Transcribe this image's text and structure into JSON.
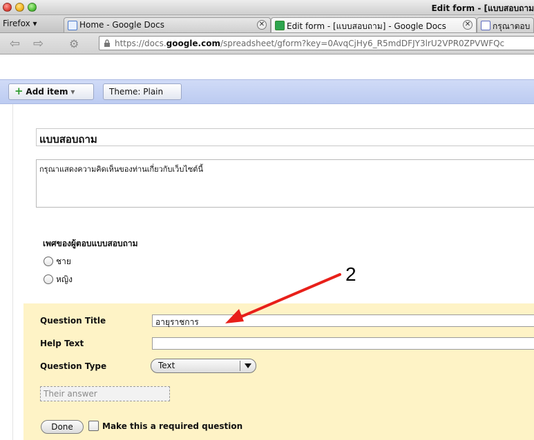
{
  "window": {
    "title": "Edit form - [แบบสอบถาม"
  },
  "tabs": [
    {
      "label": "Home - Google Docs",
      "icon": "docs-icon",
      "active": false
    },
    {
      "label": "Edit form - [แบบสอบถาม] - Google Docs",
      "icon": "spreadsheet-icon",
      "active": true
    },
    {
      "label": "กรุณาตอบ",
      "icon": "form-icon",
      "active": false
    }
  ],
  "browser": {
    "menu_label": "Firefox ▾",
    "url_prefix": "https://docs.",
    "url_domain": "google.com",
    "url_suffix": "/spreadsheet/gform?key=0AvqCjHy6_R5mdDFJY3lrU2VPR0ZPVWFQc"
  },
  "toolbar": {
    "add_item_label": "Add item",
    "theme_label": "Theme:  Plain"
  },
  "form": {
    "title": "แบบสอบถาม",
    "description": "กรุณาแสดงความคิดเห็นของท่านเกี่ยวกับเว็บไซต์นี้",
    "question_label": "เพศของผู้ตอบแบบสอบถาม",
    "options": [
      "ชาย",
      "หญิง"
    ]
  },
  "editor": {
    "question_title_label": "Question Title",
    "question_title_value": "อายุราชการ",
    "help_text_label": "Help Text",
    "help_text_value": "",
    "question_type_label": "Question Type",
    "question_type_value": "Text",
    "answer_placeholder": "Their answer",
    "done_label": "Done",
    "required_label": "Make this a required question"
  },
  "annotation": {
    "number": "2",
    "color": "#e8201a"
  }
}
